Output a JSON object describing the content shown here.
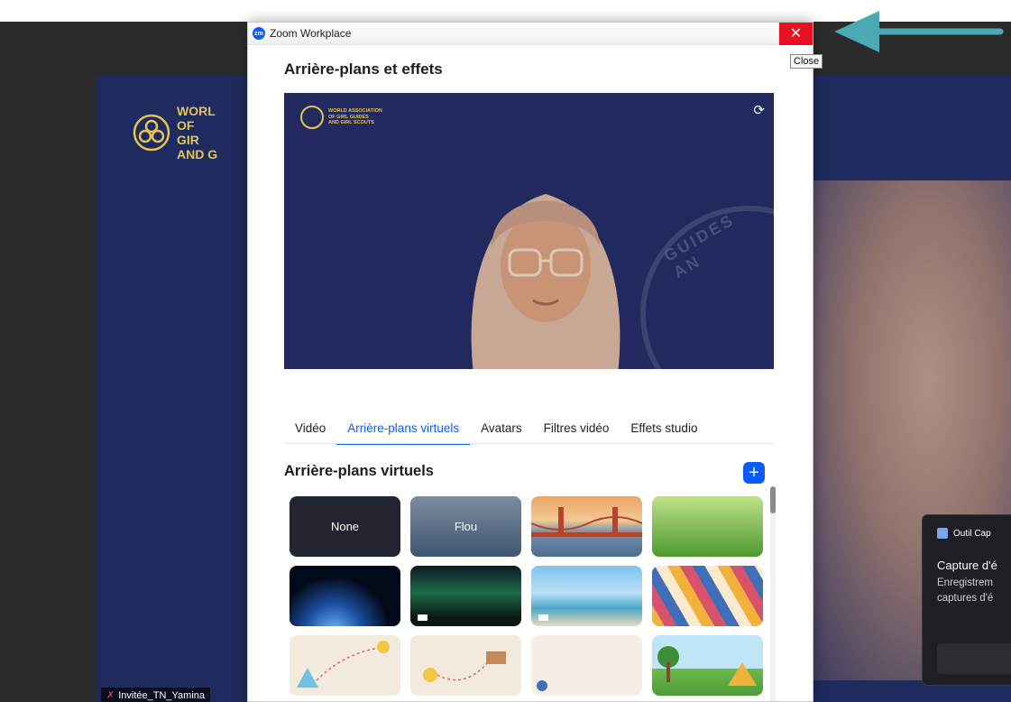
{
  "window": {
    "title": "Zoom Workplace",
    "app_icon": "zm",
    "close_glyph": "✕",
    "close_tooltip": "Close"
  },
  "dialog": {
    "heading": "Arrière-plans et effets",
    "preview": {
      "logo_text": "WORLD ASSOCIATION\nOF GIRL GUIDES\nAND GIRL SCOUTS",
      "seal_text": "GUIDES AN",
      "rotate_icon": "rotate-camera-icon"
    },
    "tabs": [
      {
        "label": "Vidéo",
        "active": false
      },
      {
        "label": "Arrière-plans virtuels",
        "active": true
      },
      {
        "label": "Avatars",
        "active": false
      },
      {
        "label": "Filtres vidéo",
        "active": false
      },
      {
        "label": "Effets studio",
        "active": false
      }
    ],
    "section_heading": "Arrière-plans virtuels",
    "add_glyph": "+",
    "backgrounds": [
      {
        "label": "None",
        "kind": "none"
      },
      {
        "label": "Flou",
        "kind": "blur"
      },
      {
        "label": "",
        "kind": "golden-gate-bridge"
      },
      {
        "label": "",
        "kind": "grass"
      },
      {
        "label": "",
        "kind": "earth-from-space"
      },
      {
        "label": "",
        "kind": "aurora",
        "video": true
      },
      {
        "label": "",
        "kind": "beach-palm",
        "video": true
      },
      {
        "label": "",
        "kind": "hexagon-badges"
      },
      {
        "label": "",
        "kind": "map-bee"
      },
      {
        "label": "",
        "kind": "map-bee-2"
      },
      {
        "label": "",
        "kind": "light-map"
      },
      {
        "label": "",
        "kind": "camping-scene"
      }
    ]
  },
  "background_meeting": {
    "logo_text": "WORL\nOF GIR\nAND G",
    "participant_name": "Invitée_TN_Yamina"
  },
  "toast": {
    "app": "Outil Cap",
    "title": "Capture d'é",
    "body": "Enregistrem\ncaptures d'é"
  },
  "colors": {
    "accent": "#0b5cff",
    "close": "#e81123",
    "annotation_arrow": "#4aa9b3",
    "frame_navy": "#22295f"
  }
}
